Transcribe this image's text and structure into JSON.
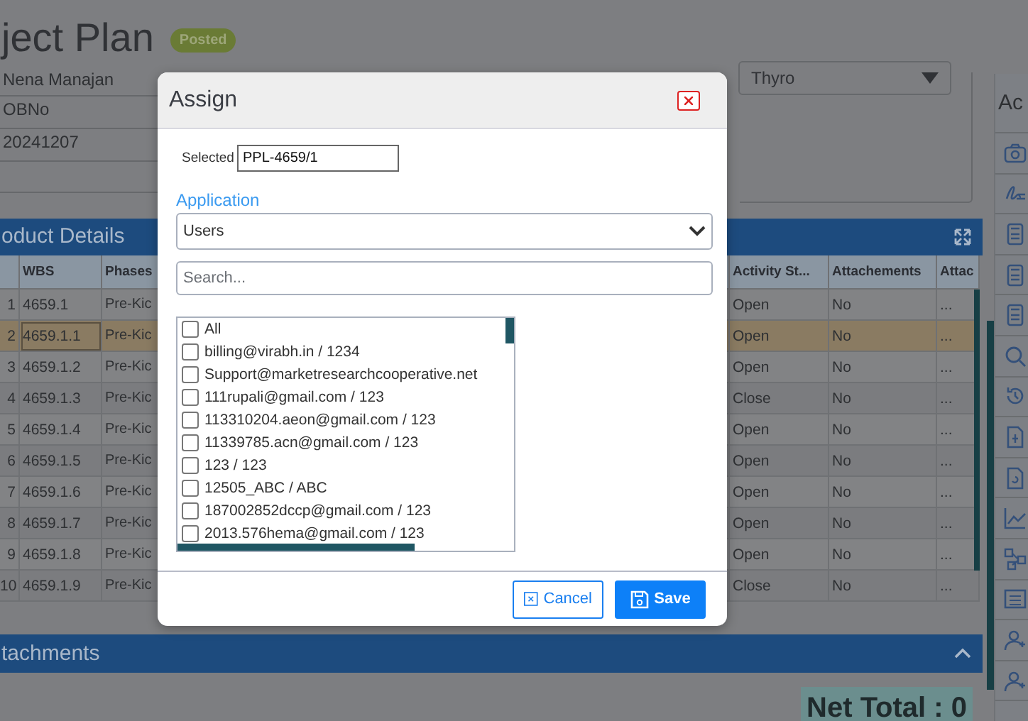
{
  "page": {
    "title": "ject Plan",
    "status_badge": "Posted"
  },
  "form": {
    "lines": [
      "Nena Manajan",
      "OBNo",
      "20241207"
    ],
    "dropdown_value": "Thyro"
  },
  "product_details": {
    "title": "oduct Details",
    "columns": [
      "WBS",
      "Phases",
      "Activity St...",
      "Attachements",
      "Attac"
    ],
    "rows": [
      {
        "number": "1",
        "wbs": "4659.1",
        "phase": "Pre-Kic",
        "activity_status": "Open",
        "attachments": "No",
        "column_7": "...",
        "selected": false
      },
      {
        "number": "2",
        "wbs": "4659.1.1",
        "phase": "Pre-Kic",
        "activity_status": "Open",
        "attachments": "No",
        "column_7": "...",
        "selected": true
      },
      {
        "number": "3",
        "wbs": "4659.1.2",
        "phase": "Pre-Kic",
        "activity_status": "Open",
        "attachments": "No",
        "column_7": "...",
        "selected": false
      },
      {
        "number": "4",
        "wbs": "4659.1.3",
        "phase": "Pre-Kic",
        "activity_status": "Close",
        "attachments": "No",
        "column_7": "...",
        "selected": false
      },
      {
        "number": "5",
        "wbs": "4659.1.4",
        "phase": "Pre-Kic",
        "activity_status": "Open",
        "attachments": "No",
        "column_7": "...",
        "selected": false
      },
      {
        "number": "6",
        "wbs": "4659.1.5",
        "phase": "Pre-Kic",
        "activity_status": "Open",
        "attachments": "No",
        "column_7": "...",
        "selected": false
      },
      {
        "number": "7",
        "wbs": "4659.1.6",
        "phase": "Pre-Kic",
        "activity_status": "Open",
        "attachments": "No",
        "column_7": "...",
        "selected": false
      },
      {
        "number": "8",
        "wbs": "4659.1.7",
        "phase": "Pre-Kic",
        "activity_status": "Open",
        "attachments": "No",
        "column_7": "...",
        "selected": false
      },
      {
        "number": "9",
        "wbs": "4659.1.8",
        "phase": "Pre-Kic",
        "activity_status": "Open",
        "attachments": "No",
        "column_7": "...",
        "selected": false
      },
      {
        "number": "10",
        "wbs": "4659.1.9",
        "phase": "Pre-Kic",
        "activity_status": "Close",
        "attachments": "No",
        "column_7": "...",
        "selected": false
      }
    ]
  },
  "attachments_panel": {
    "title": "tachments",
    "expanded": true
  },
  "net_total": "Net Total : 0",
  "sidebar": {
    "title": "Ac"
  },
  "dialog": {
    "title": "Assign",
    "selected_label": "Selected",
    "selected_value": "PPL-4659/1",
    "application_label": "Application",
    "application_value": "Users",
    "search_placeholder": "Search...",
    "users": [
      {
        "label": "All",
        "checked": false
      },
      {
        "label": "billing@virabh.in / 1234",
        "checked": false
      },
      {
        "label": "Support@marketresearchcooperative.net",
        "checked": false
      },
      {
        "label": "111rupali@gmail.com / 123",
        "checked": false
      },
      {
        "label": "113310204.aeon@gmail.com / 123",
        "checked": false
      },
      {
        "label": "11339785.acn@gmail.com / 123",
        "checked": false
      },
      {
        "label": "123 / 123",
        "checked": false
      },
      {
        "label": "12505_ABC / ABC",
        "checked": false
      },
      {
        "label": "187002852dccp@gmail.com / 123",
        "checked": false
      },
      {
        "label": "2013.576hema@gmail.com / 123",
        "checked": false
      }
    ],
    "buttons": [
      {
        "label": "Cancel",
        "kind": "secondary"
      },
      {
        "label": "Save",
        "kind": "primary"
      }
    ]
  }
}
